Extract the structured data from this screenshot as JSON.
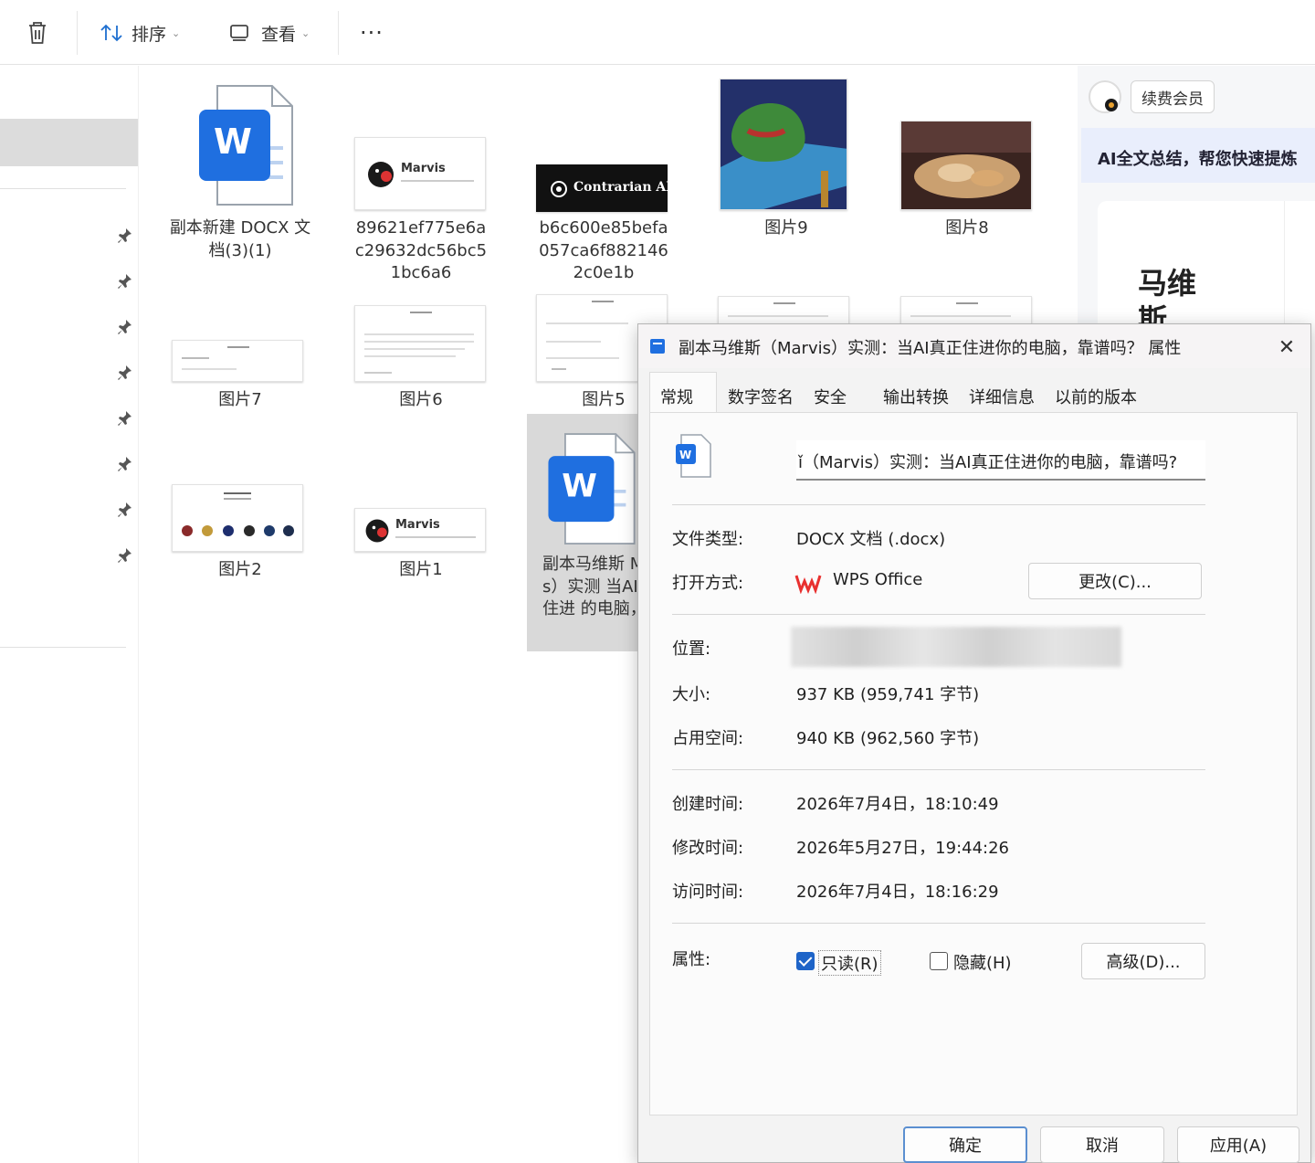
{
  "toolbar": {
    "sort_label": "排序",
    "view_label": "查看",
    "more_label": "···"
  },
  "files": [
    {
      "label": "副本新建 DOCX 文档(3)(1)",
      "kind": "word"
    },
    {
      "label": "89621ef775e6ac29632dc56bc51bc6a6",
      "kind": "thumb-marvis"
    },
    {
      "label": "b6c600e85befa057ca6f8821462c0e1b",
      "kind": "thumb-contrarian"
    },
    {
      "label": "图片9",
      "kind": "image"
    },
    {
      "label": "图片8",
      "kind": "image"
    },
    {
      "label": "图片7",
      "kind": "thumb-doc"
    },
    {
      "label": "图片6",
      "kind": "thumb-doc"
    },
    {
      "label": "图片5",
      "kind": "thumb-doc"
    },
    {
      "label": "图片2",
      "kind": "thumb-icons"
    },
    {
      "label": "图片1",
      "kind": "thumb-marvis"
    },
    {
      "label": "副本马维斯（Marvis）实测：当AI真正住进你的电脑，靠谱吗?",
      "kind": "word",
      "visible": "副本马维斯 Marvis）实测 当AI真正住进 的电脑，靠谱"
    }
  ],
  "thumbs": {
    "marvis_text": "Marvis",
    "contrarian_text": "Contrarian AI"
  },
  "right_pane": {
    "renew_label": "续费会员",
    "ai_banner": "AI全文总结，帮您快速提炼",
    "doc_title": "马维斯"
  },
  "dialog": {
    "title": "副本马维斯（Marvis）实测：当AI真正住进你的电脑，靠谱吗？ 属性",
    "tabs": [
      "常规",
      "数字签名",
      "安全",
      "输出转换",
      "详细信息",
      "以前的版本"
    ],
    "file_name": "ǐ（Marvis）实测：当AI真正住进你的电脑，靠谱吗?",
    "rows": {
      "type_label": "文件类型:",
      "type_value": "DOCX 文档 (.docx)",
      "open_label": "打开方式:",
      "open_value": "WPS Office",
      "change_button": "更改(C)...",
      "location_label": "位置:",
      "size_label": "大小:",
      "size_value": "937 KB (959,741 字节)",
      "disk_label": "占用空间:",
      "disk_value": "940 KB (962,560 字节)",
      "created_label": "创建时间:",
      "created_value": "2026年7月4日，18:10:49",
      "modified_label": "修改时间:",
      "modified_value": "2026年5月27日，19:44:26",
      "accessed_label": "访问时间:",
      "accessed_value": "2026年7月4日，18:16:29",
      "attr_label": "属性:",
      "readonly_label": "只读(R)",
      "readonly_checked": true,
      "hidden_label": "隐藏(H)",
      "hidden_checked": false,
      "advanced_button": "高级(D)..."
    },
    "buttons": {
      "ok": "确定",
      "cancel": "取消",
      "apply": "应用(A)"
    }
  },
  "colors": {
    "word_blue": "#1f6fe0",
    "wps_red": "#e8302f",
    "checkbox_blue": "#1e64c8"
  }
}
